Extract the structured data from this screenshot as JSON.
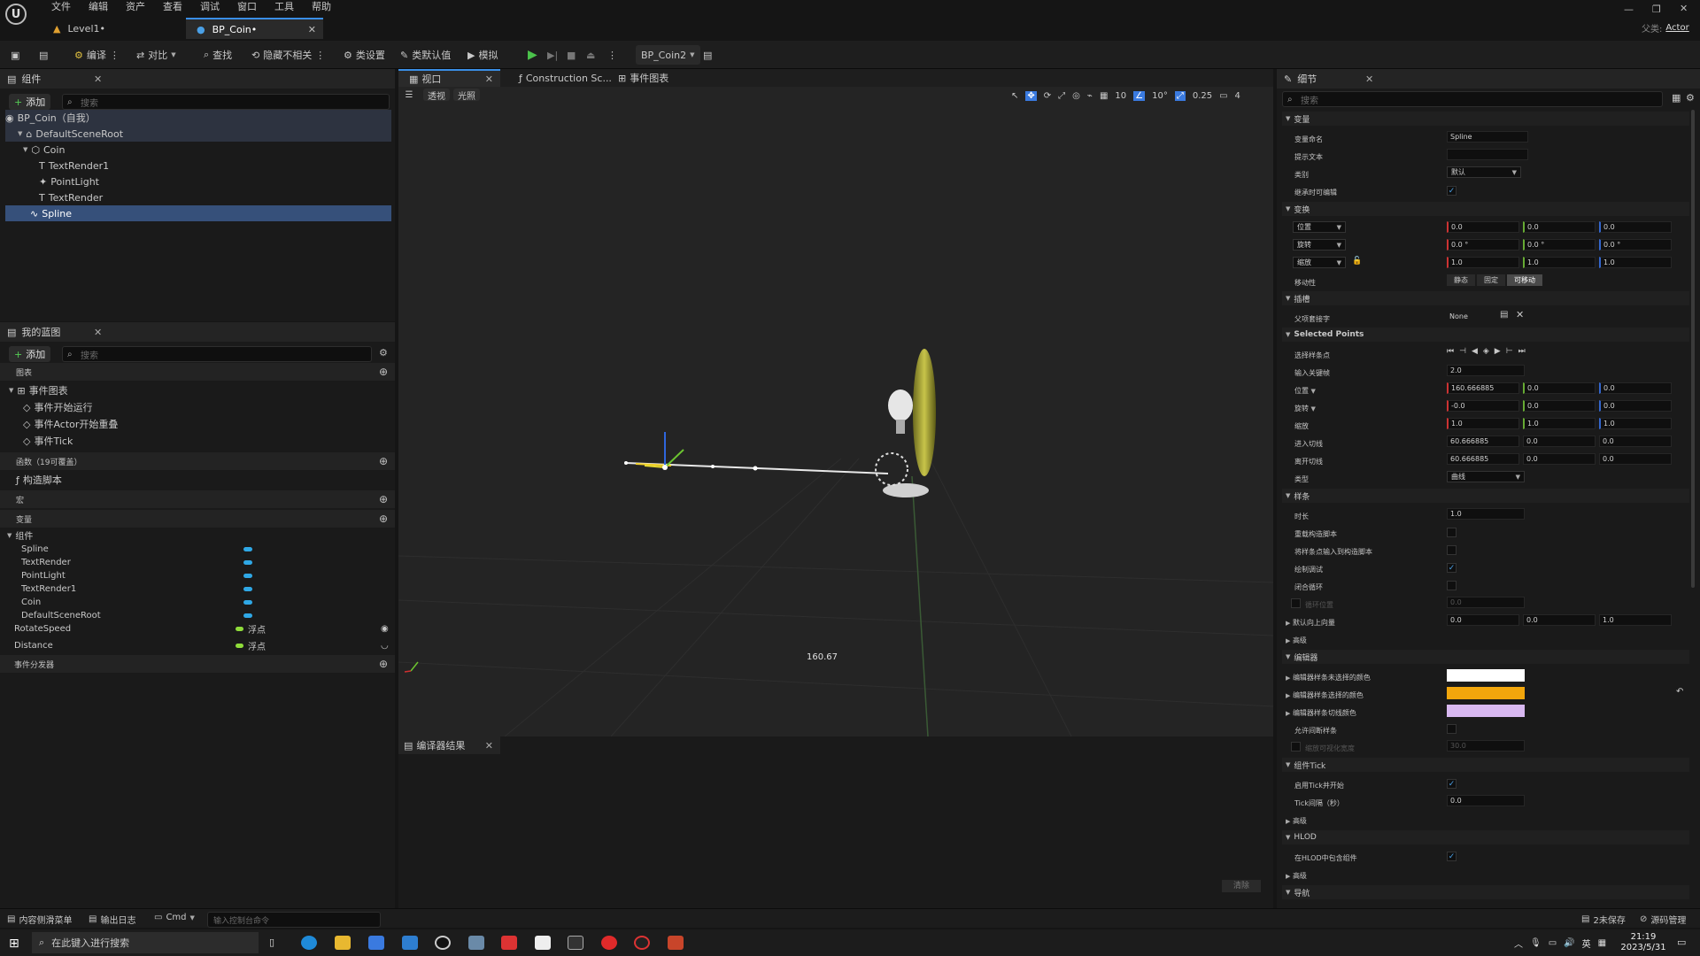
{
  "menu": [
    "文件",
    "编辑",
    "资产",
    "查看",
    "调试",
    "窗口",
    "工具",
    "帮助"
  ],
  "tabs": {
    "level": "Level1•",
    "bp": "BP_Coin•"
  },
  "window_right": {
    "parent_label": "父类:",
    "parent_value": "Actor"
  },
  "toolbar": {
    "compile": "编译",
    "diff": "对比",
    "find": "查找",
    "hide_unrelated": "隐藏不相关",
    "class_settings": "类设置",
    "class_defaults": "类默认值",
    "simulate": "模拟",
    "debug_target": "BP_Coin2"
  },
  "components": {
    "title": "组件",
    "add": "添加",
    "search_placeholder": "搜索",
    "items": [
      "BP_Coin（自我）",
      "DefaultSceneRoot",
      "Coin",
      "TextRender1",
      "PointLight",
      "TextRender",
      "Spline"
    ]
  },
  "blueprint": {
    "title": "我的蓝图",
    "add": "添加",
    "search_placeholder": "搜索",
    "graphs_label": "图表",
    "event_graph": "事件图表",
    "events": [
      "事件开始运行",
      "事件Actor开始重叠",
      "事件Tick"
    ],
    "functions_label": "函数（19可覆盖）",
    "construction": "构造脚本",
    "macros_label": "宏",
    "variables_label": "变量",
    "components_label": "组件",
    "component_vars": [
      "Spline",
      "TextRender",
      "PointLight",
      "TextRender1",
      "Coin",
      "DefaultSceneRoot"
    ],
    "vars": [
      {
        "name": "RotateSpeed",
        "type": "浮点"
      },
      {
        "name": "Distance",
        "type": "浮点"
      }
    ],
    "dispatchers_label": "事件分发器"
  },
  "viewport": {
    "tabs": [
      "视口",
      "Construction Sc...",
      "事件图表"
    ],
    "mode_perspective": "透视",
    "mode_lit": "光照",
    "grid": "10",
    "angle": "10°",
    "scale": "0.25",
    "camera": "4",
    "distance_label": "160.67"
  },
  "compiler": {
    "title": "编译器结果",
    "clear": "清除"
  },
  "details": {
    "title": "细节",
    "search_placeholder": "搜索",
    "sections": {
      "variable": "变量",
      "transform": "变换",
      "sockets": "插槽",
      "selected_points": "Selected Points",
      "spline": "样条",
      "advanced": "高级",
      "editor": "编辑器",
      "component_tick": "组件Tick",
      "advanced2": "高级",
      "hlod": "HLOD",
      "advanced3": "高级",
      "navigation": "导航"
    },
    "labels": {
      "var_name": "变量命名",
      "tooltip": "提示文本",
      "category": "类别",
      "editable_when_inherited": "继承时可编辑",
      "location": "位置",
      "rotation": "旋转",
      "scale": "缩放",
      "mobility": "移动性",
      "parent_socket": "父项套接字",
      "select_points": "选择样条点",
      "input_key": "输入关键帧",
      "pt_location": "位置",
      "pt_rotation": "旋转",
      "pt_scale": "缩放",
      "arrive_tangent": "进入切线",
      "leave_tangent": "离开切线",
      "pt_type": "类型",
      "duration": "时长",
      "override_construction": "重载构造脚本",
      "input_spline_points": "将样条点输入到构造脚本",
      "draw_debug": "绘制调试",
      "closed_loop": "闭合循环",
      "loop_position": "循环位置",
      "default_up": "默认向上向量",
      "unselected_color": "编辑器样条未选择的颜色",
      "selected_color": "编辑器样条选择的颜色",
      "tangent_color": "编辑器样条切线颜色",
      "allow_discontinuous": "允许间断样条",
      "scale_visualization": "缩放可视化宽度",
      "tick_start": "启用Tick并开始",
      "tick_interval": "Tick间隔（秒）",
      "include_hlod": "在HLOD中包含组件"
    },
    "values": {
      "var_name": "Spline",
      "category": "默认",
      "location": [
        "0.0",
        "0.0",
        "0.0"
      ],
      "rotation": [
        "0.0 °",
        "0.0 °",
        "0.0 °"
      ],
      "scale": [
        "1.0",
        "1.0",
        "1.0"
      ],
      "mobility": [
        "静态",
        "固定",
        "可移动"
      ],
      "parent_socket": "None",
      "input_key": "2.0",
      "pt_location": [
        "160.666885",
        "0.0",
        "0.0"
      ],
      "pt_rotation": [
        "-0.0",
        "0.0",
        "0.0"
      ],
      "pt_scale": [
        "1.0",
        "1.0",
        "1.0"
      ],
      "arrive_tangent": [
        "60.666885",
        "0.0",
        "0.0"
      ],
      "leave_tangent": [
        "60.666885",
        "0.0",
        "0.0"
      ],
      "pt_type": "曲线",
      "duration": "1.0",
      "loop_position": "0.0",
      "default_up": [
        "0.0",
        "0.0",
        "1.0"
      ],
      "scale_visualization": "30.0",
      "tick_interval": "0.0"
    },
    "colors": {
      "unselected": "#ffffff",
      "selected": "#f2a60c",
      "tangent": "#d8b8f0"
    }
  },
  "statusbar": {
    "content_drawer": "内容侧滑菜单",
    "output_log": "输出日志",
    "cmd": "Cmd",
    "console_placeholder": "输入控制台命令",
    "unsaved": "2未保存",
    "source_control": "源码管理"
  },
  "taskbar": {
    "search_placeholder": "在此键入进行搜索",
    "time": "21:19",
    "date": "2023/5/31",
    "lang": "英"
  }
}
